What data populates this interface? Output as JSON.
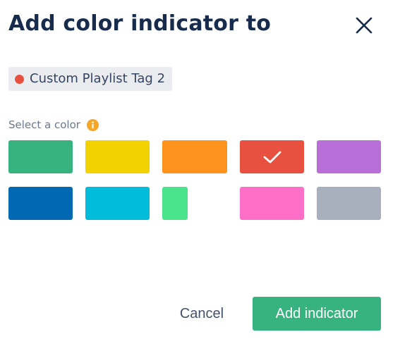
{
  "dialog": {
    "title": "Add color indicator to",
    "close_icon": "close-icon"
  },
  "tag": {
    "label": "Custom Playlist Tag 2",
    "color": "#e8513f"
  },
  "color_picker": {
    "label": "Select a color",
    "info_icon": "info-icon",
    "info_color": "#f5a623",
    "selected_color": "#e8513f",
    "check_icon": "check-icon",
    "swatches": [
      {
        "id": "green",
        "color": "#36b37e",
        "selected": false
      },
      {
        "id": "yellow",
        "color": "#f2d200",
        "selected": false
      },
      {
        "id": "orange",
        "color": "#ff931e",
        "selected": false
      },
      {
        "id": "red",
        "color": "#e8513f",
        "selected": true
      },
      {
        "id": "purple",
        "color": "#b86fd8",
        "selected": false
      },
      {
        "id": "blue",
        "color": "#0168b3",
        "selected": false
      },
      {
        "id": "cyan",
        "color": "#00bcdb",
        "selected": false
      },
      {
        "id": "light-green",
        "color": "#48e38b",
        "selected": false
      },
      {
        "id": "pink",
        "color": "#ff6ec7",
        "selected": false
      },
      {
        "id": "gray",
        "color": "#a9b0bd",
        "selected": false
      }
    ]
  },
  "footer": {
    "cancel_label": "Cancel",
    "submit_label": "Add indicator",
    "submit_color": "#36b37e"
  }
}
